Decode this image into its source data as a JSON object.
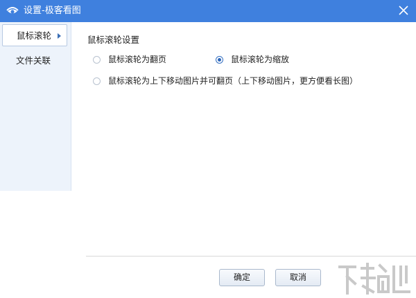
{
  "window": {
    "title": "设置-极客看图",
    "app_icon": "eye-icon",
    "close_icon": "close-icon"
  },
  "sidebar": {
    "items": [
      {
        "label": "鼠标滚轮",
        "active": true,
        "icon": "chevron-right-icon"
      },
      {
        "label": "文件关联",
        "active": false
      }
    ]
  },
  "main": {
    "section_title": "鼠标滚轮设置",
    "options": [
      {
        "label": "鼠标滚轮为翻页",
        "checked": false
      },
      {
        "label": "鼠标滚轮为缩放",
        "checked": true
      },
      {
        "label": "鼠标滚轮为上下移动图片并可翻页（上下移动图片，更方便看长图）",
        "checked": false
      }
    ]
  },
  "footer": {
    "ok_label": "确定",
    "cancel_label": "取消"
  },
  "watermark": {
    "logo": "xiazaiba-watermark-logo"
  },
  "colors": {
    "titlebar": "#3f80de",
    "sidebar_bg": "#edf3fb",
    "radio_checked": "#2a64b8"
  }
}
